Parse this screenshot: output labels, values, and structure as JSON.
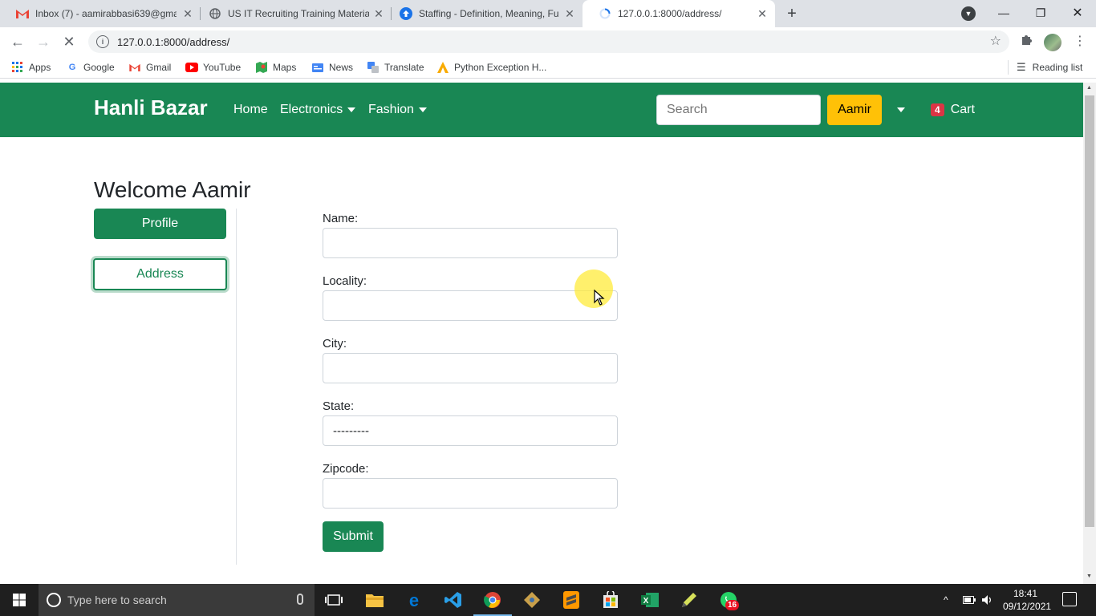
{
  "browser": {
    "tabs": [
      {
        "title": "Inbox (7) - aamirabbasi639@gma",
        "icon": "gmail-icon"
      },
      {
        "title": "US IT Recruiting Training Materia",
        "icon": "globe-icon"
      },
      {
        "title": "Staffing - Definition, Meaning, Fu",
        "icon": "upload-icon"
      },
      {
        "title": "127.0.0.1:8000/address/",
        "icon": "loading-spinner-icon",
        "active": true
      }
    ],
    "url": "127.0.0.1:8000/address/",
    "bookmarks": [
      {
        "label": "Apps",
        "icon": "apps-grid-icon"
      },
      {
        "label": "Google",
        "icon": "google-icon"
      },
      {
        "label": "Gmail",
        "icon": "gmail-icon"
      },
      {
        "label": "YouTube",
        "icon": "youtube-icon"
      },
      {
        "label": "Maps",
        "icon": "maps-icon"
      },
      {
        "label": "News",
        "icon": "news-icon"
      },
      {
        "label": "Translate",
        "icon": "translate-icon"
      },
      {
        "label": "Python Exception H...",
        "icon": "a-logo-icon"
      }
    ],
    "reading_list": "Reading list"
  },
  "site": {
    "brand": "Hanli Bazar",
    "nav": {
      "home": "Home",
      "electronics": "Electronics",
      "fashion": "Fashion"
    },
    "search_placeholder": "Search",
    "user": "Aamir",
    "cart_count": "4",
    "cart_label": "Cart",
    "colors": {
      "primary": "#198754",
      "warning": "#ffc107",
      "danger": "#dc3545"
    }
  },
  "main": {
    "welcome": "Welcome Aamir",
    "sidebar": {
      "profile": "Profile",
      "address": "Address"
    },
    "form": {
      "name_label": "Name:",
      "locality_label": "Locality:",
      "city_label": "City:",
      "state_label": "State:",
      "state_value": "---------",
      "zipcode_label": "Zipcode:",
      "submit": "Submit"
    }
  },
  "taskbar": {
    "search_placeholder": "Type here to search",
    "whatsapp_badge": "16",
    "time": "18:41",
    "date": "09/12/2021"
  }
}
